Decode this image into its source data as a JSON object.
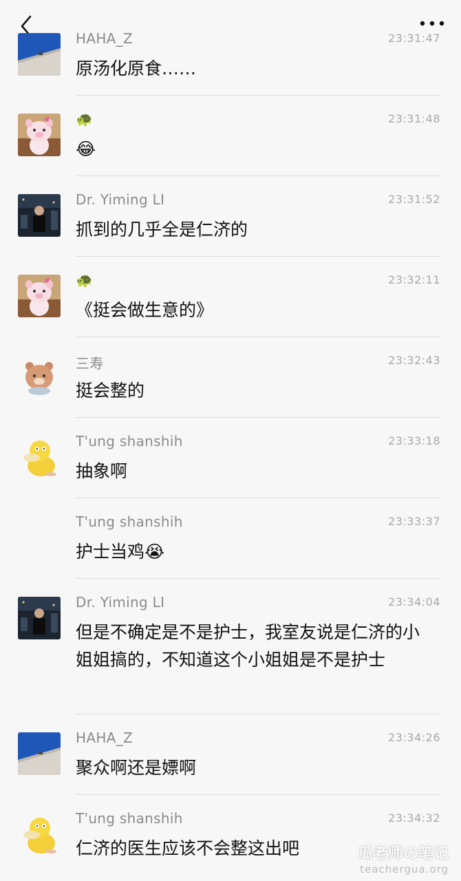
{
  "header": {
    "back_icon": "chevron-left-icon",
    "more_icon": "more-dots-icon"
  },
  "messages": [
    {
      "name": "HAHA_Z",
      "time": "23:31:47",
      "text": "原汤化原食……",
      "avatar": "sky-wall-avatar"
    },
    {
      "name": "🐢",
      "time": "23:31:48",
      "text": "😂",
      "avatar": "pink-pig-avatar"
    },
    {
      "name": "Dr. Yiming LI",
      "time": "23:31:52",
      "text": "抓到的几乎全是仁济的",
      "avatar": "night-photo-avatar"
    },
    {
      "name": "🐢",
      "time": "23:32:11",
      "text": "《挺会做生意的》",
      "avatar": "pink-pig-avatar"
    },
    {
      "name": "三寿",
      "time": "23:32:43",
      "text": "挺会整的",
      "avatar": "brown-bear-avatar"
    },
    {
      "name": "T'ung shanshih",
      "time": "23:33:18",
      "text": "抽象啊",
      "avatar": "yellow-duck-avatar"
    },
    {
      "name": "T'ung shanshih",
      "time": "23:33:37",
      "text": "护士当鸡😭",
      "avatar": ""
    },
    {
      "name": "Dr. Yiming LI",
      "time": "23:34:04",
      "text": "但是不确定是不是护士，我室友说是仁济的小姐姐搞的，不知道这个小姐姐是不是护士",
      "avatar": "night-photo-avatar"
    },
    {
      "name": "HAHA_Z",
      "time": "23:34:26",
      "text": "聚众啊还是嫖啊",
      "avatar": "sky-wall-avatar"
    },
    {
      "name": "T'ung shanshih",
      "time": "23:34:32",
      "text": "仁济的医生应该不会整这出吧",
      "avatar": "yellow-duck-avatar"
    }
  ],
  "watermark": {
    "main": "瓜老师の笔记",
    "sub": "teachergua.org"
  }
}
